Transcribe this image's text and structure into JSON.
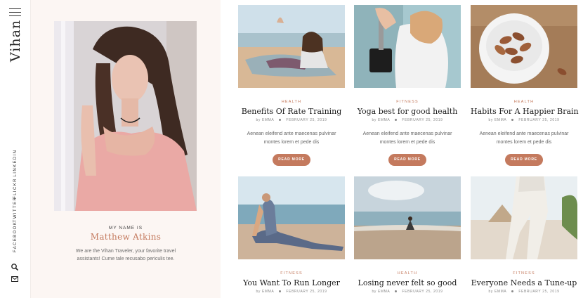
{
  "brand": {
    "name": "Vihan"
  },
  "social": [
    "LINKEDIN",
    "FLICKR",
    "TWITTER",
    "FACEBOOK"
  ],
  "icons": {
    "menu": "hamburger-icon",
    "search": "search-icon",
    "mail": "mail-icon"
  },
  "profile": {
    "kicker": "MY NAME IS",
    "name": "Matthew Atkins",
    "bio": "We are the Vihan Traveler, your favorite travel assistants! Cume tale recusabo periculis tee."
  },
  "colors": {
    "accent": "#c47a5e",
    "panel": "#fcf6f3"
  },
  "posts": [
    {
      "category": "HEALTH",
      "title": "Benefits Of Rate Training",
      "author": "by EMMA",
      "date": "FEBRUARY 25, 2019",
      "excerpt": "Aenean eleifend ante maecenas pulvinar montes lorem et pede dis",
      "button": "READ MORE"
    },
    {
      "category": "FITNESS",
      "title": "Yoga best for good health",
      "author": "by EMMA",
      "date": "FEBRUARY 25, 2019",
      "excerpt": "Aenean eleifend ante maecenas pulvinar montes lorem et pede dis",
      "button": "READ MORE"
    },
    {
      "category": "HEALTH",
      "title": "Habits For A Happier Brain",
      "author": "by EMMA",
      "date": "FEBRUARY 25, 2019",
      "excerpt": "Aenean eleifend ante maecenas pulvinar montes lorem et pede dis",
      "button": "READ MORE"
    },
    {
      "category": "FITNESS",
      "title": "You Want To Run Longer",
      "author": "by EMMA",
      "date": "FEBRUARY 25, 2019"
    },
    {
      "category": "HEALTH",
      "title": "Losing never felt so good",
      "author": "by EMMA",
      "date": "FEBRUARY 25, 2019"
    },
    {
      "category": "FITNESS",
      "title": "Everyone Needs a Tune-up",
      "author": "by EMMA",
      "date": "FEBRUARY 25, 2019"
    }
  ]
}
